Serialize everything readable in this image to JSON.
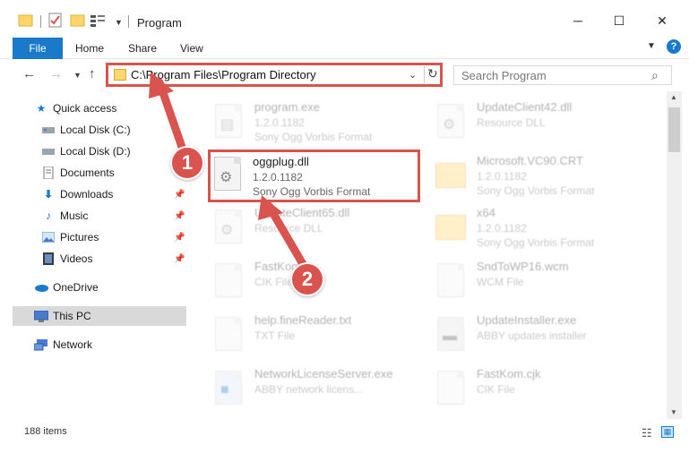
{
  "window": {
    "title": "Program",
    "minimize_icon": "─",
    "maximize_icon": "☐",
    "close_icon": "✕"
  },
  "ribbon": {
    "tabs": [
      "File",
      "Home",
      "Share",
      "View"
    ]
  },
  "address": {
    "path": "C:\\Program Files\\Program Directory",
    "search_placeholder": "Search Program"
  },
  "nav": {
    "items": [
      {
        "label": "Quick access",
        "icon": "star-icon",
        "pinned": false
      },
      {
        "label": "Local Disk (C:)",
        "icon": "drive-icon",
        "pinned": false
      },
      {
        "label": "Local Disk (D:)",
        "icon": "drive-icon",
        "pinned": false
      },
      {
        "label": "Documents",
        "icon": "documents-icon",
        "pinned": false
      },
      {
        "label": "Downloads",
        "icon": "download-icon",
        "pinned": true
      },
      {
        "label": "Music",
        "icon": "music-icon",
        "pinned": true
      },
      {
        "label": "Pictures",
        "icon": "pictures-icon",
        "pinned": true
      },
      {
        "label": "Videos",
        "icon": "videos-icon",
        "pinned": true
      },
      {
        "label": "OneDrive",
        "icon": "cloud-icon",
        "pinned": false
      },
      {
        "label": "This PC",
        "icon": "computer-icon",
        "pinned": false
      },
      {
        "label": "Network",
        "icon": "network-icon",
        "pinned": false
      }
    ],
    "selected": "This PC"
  },
  "files": {
    "left": [
      {
        "name": "program.exe",
        "line1": "1.2.0.1182",
        "line2": "Sony Ogg Vorbis Format"
      },
      {
        "name": "oggplug.dll",
        "line1": "1.2.0.1182",
        "line2": "Sony Ogg Vorbis Format"
      },
      {
        "name": "UpdateClient65.dll",
        "line1": "Resource DLL",
        "line2": ""
      },
      {
        "name": "FastKom...",
        "line1": "CIK File",
        "line2": ""
      },
      {
        "name": "help.fineReader.txt",
        "line1": "TXT File",
        "line2": ""
      },
      {
        "name": "NetworkLicenseServer.exe",
        "line1": "ABBY network licens...",
        "line2": ""
      }
    ],
    "right": [
      {
        "name": "UpdateClient42.dll",
        "line1": "Resource DLL",
        "line2": ""
      },
      {
        "name": "Microsoft.VC90.CRT",
        "line1": "1.2.0.1182",
        "line2": "Sony Ogg Vorbis Format"
      },
      {
        "name": "x64",
        "line1": "1.2.0.1182",
        "line2": "Sony Ogg Vorbis Format"
      },
      {
        "name": "SndToWP16.wcm",
        "line1": "WCM File",
        "line2": ""
      },
      {
        "name": "UpdateInstaller.exe",
        "line1": "ABBY updates installer",
        "line2": ""
      },
      {
        "name": "FastKom.cjk",
        "line1": "CIK File",
        "line2": ""
      }
    ]
  },
  "status": {
    "count": "188 items"
  },
  "callouts": {
    "one": "1",
    "two": "2",
    "color": "#d9534f"
  }
}
